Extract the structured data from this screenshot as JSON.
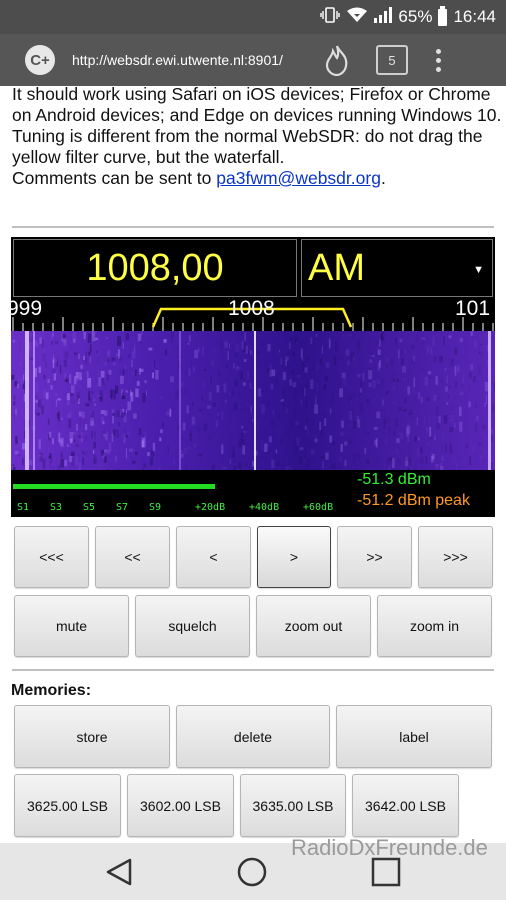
{
  "status_bar": {
    "battery": "65%",
    "time": "16:44",
    "icons": [
      "vibrate-icon",
      "wifi-icon",
      "signal-icon",
      "battery-icon"
    ]
  },
  "browser": {
    "url": "http://websdr.ewi.utwente.nl:8901/",
    "tab_count": "5",
    "icons": [
      "c-plus-icon",
      "flame-icon",
      "tabs-icon",
      "overflow-menu-icon"
    ]
  },
  "intro": {
    "line1": "It should work using Safari on iOS devices; Firefox or Chrome on Android devices; and Edge on devices running Windows 10.",
    "line2": "Tuning is different from the normal WebSDR: do not drag the yellow filter curve, but the waterfall.",
    "line3_prefix": "Comments can be sent to ",
    "email": "pa3fwm@websdr.org",
    "line3_suffix": "."
  },
  "sdr": {
    "frequency": "1008,00",
    "mode": "AM",
    "mode_arrow": "▼",
    "scale_labels": [
      "999",
      "1008",
      "101"
    ],
    "signal_dbm": "-51.3 dBm",
    "signal_peak": "-51.2 dBm peak",
    "smeter_labels": [
      "S1",
      "S3",
      "S5",
      "S7",
      "S9",
      "+20dB",
      "+40dB",
      "+60dB"
    ],
    "smeter_level": 0.42,
    "colors": {
      "freq_text": "#ffff44",
      "dbm_text": "#33ee33",
      "peak_text": "#ff9922",
      "waterfall": "#3a1a9a"
    }
  },
  "tuning_buttons": [
    "<<<",
    "<<",
    "<",
    ">",
    ">>",
    ">>>"
  ],
  "control_buttons": [
    "mute",
    "squelch",
    "zoom out",
    "zoom in"
  ],
  "memories": {
    "title": "Memories:",
    "actions": [
      "store",
      "delete",
      "label"
    ],
    "presets": [
      "3625.00 LSB",
      "3602.00 LSB",
      "3635.00 LSB",
      "3642.00 LSB"
    ]
  },
  "watermark": "RadioDxFreunde.de",
  "nav_bar": {
    "icons": [
      "back-icon",
      "home-icon",
      "recents-icon"
    ]
  }
}
